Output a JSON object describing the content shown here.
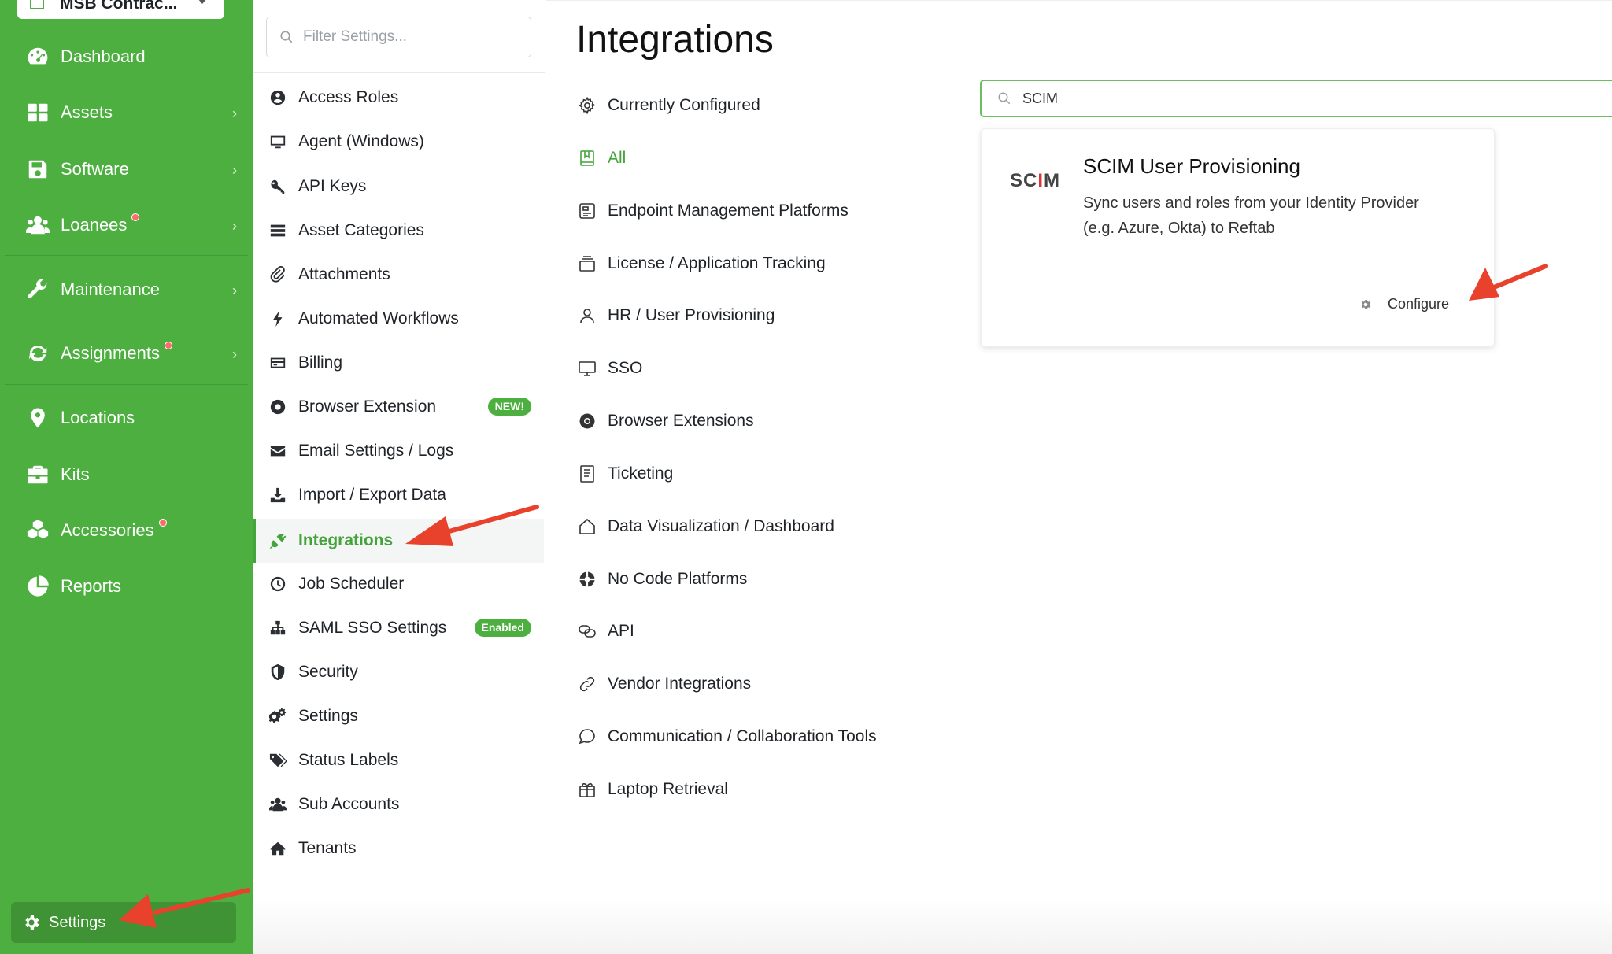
{
  "org": {
    "name": "MSB Contrac..."
  },
  "nav": {
    "items": [
      {
        "label": "Dashboard",
        "icon": "dashboard-icon"
      },
      {
        "label": "Assets",
        "icon": "grid-icon",
        "chevron": true
      },
      {
        "label": "Software",
        "icon": "save-icon",
        "chevron": true
      },
      {
        "label": "Loanees",
        "icon": "users-icon",
        "chevron": true,
        "dot": true
      },
      {
        "label": "Maintenance",
        "icon": "wrench-icon",
        "chevron": true
      },
      {
        "label": "Assignments",
        "icon": "sync-icon",
        "chevron": true,
        "dot": true
      },
      {
        "label": "Locations",
        "icon": "map-pin-icon"
      },
      {
        "label": "Kits",
        "icon": "briefcase-icon"
      },
      {
        "label": "Accessories",
        "icon": "cubes-icon",
        "dot": true
      },
      {
        "label": "Reports",
        "icon": "pie-chart-icon"
      }
    ],
    "settings_label": "Settings",
    "chevron_glyph": "›"
  },
  "settings": {
    "filter_placeholder": "Filter Settings...",
    "items": [
      {
        "label": "Access Roles",
        "icon": "user-circle-icon"
      },
      {
        "label": "Agent (Windows)",
        "icon": "monitor-icon"
      },
      {
        "label": "API Keys",
        "icon": "key-icon"
      },
      {
        "label": "Asset Categories",
        "icon": "list-icon"
      },
      {
        "label": "Attachments",
        "icon": "paperclip-icon"
      },
      {
        "label": "Automated Workflows",
        "icon": "bolt-icon"
      },
      {
        "label": "Billing",
        "icon": "credit-card-icon"
      },
      {
        "label": "Browser Extension",
        "icon": "chrome-icon",
        "badge": "NEW!"
      },
      {
        "label": "Email Settings / Logs",
        "icon": "envelope-icon"
      },
      {
        "label": "Import / Export Data",
        "icon": "download-icon"
      },
      {
        "label": "Integrations",
        "icon": "plug-icon",
        "active": true
      },
      {
        "label": "Job Scheduler",
        "icon": "clock-icon"
      },
      {
        "label": "SAML SSO Settings",
        "icon": "sitemap-icon",
        "badge": "Enabled"
      },
      {
        "label": "Security",
        "icon": "shield-icon"
      },
      {
        "label": "Settings",
        "icon": "cogs-icon"
      },
      {
        "label": "Status Labels",
        "icon": "tags-icon"
      },
      {
        "label": "Sub Accounts",
        "icon": "users-icon"
      },
      {
        "label": "Tenants",
        "icon": "home-icon"
      }
    ]
  },
  "main": {
    "title": "Integrations",
    "categories": [
      {
        "label": "Currently Configured",
        "icon": "gear-icon"
      },
      {
        "label": "All",
        "icon": "bookmark-icon",
        "active": true
      },
      {
        "label": "Endpoint Management Platforms",
        "icon": "device-icon"
      },
      {
        "label": "License / Application Tracking",
        "icon": "stack-icon"
      },
      {
        "label": "HR / User Provisioning",
        "icon": "user-icon"
      },
      {
        "label": "SSO",
        "icon": "monitor-icon"
      },
      {
        "label": "Browser Extensions",
        "icon": "chrome-icon"
      },
      {
        "label": "Ticketing",
        "icon": "document-icon"
      },
      {
        "label": "Data Visualization / Dashboard",
        "icon": "house-icon"
      },
      {
        "label": "No Code Platforms",
        "icon": "lifebuoy-icon"
      },
      {
        "label": "API",
        "icon": "chain-icon"
      },
      {
        "label": "Vendor Integrations",
        "icon": "link-icon"
      },
      {
        "label": "Communication / Collaboration Tools",
        "icon": "chat-icon"
      },
      {
        "label": "Laptop Retrieval",
        "icon": "gift-icon"
      }
    ],
    "search_value": "SCIM",
    "card": {
      "logo_left": "SC",
      "logo_mid": "I",
      "logo_right": "M",
      "title": "SCIM User Provisioning",
      "description": "Sync users and roles from your Identity Provider (e.g. Azure, Okta) to Reftab",
      "configure_label": "Configure"
    }
  },
  "colors": {
    "brand_green": "#4caf3f",
    "active_green": "#44a33a",
    "arrow_red": "#e8412c"
  }
}
